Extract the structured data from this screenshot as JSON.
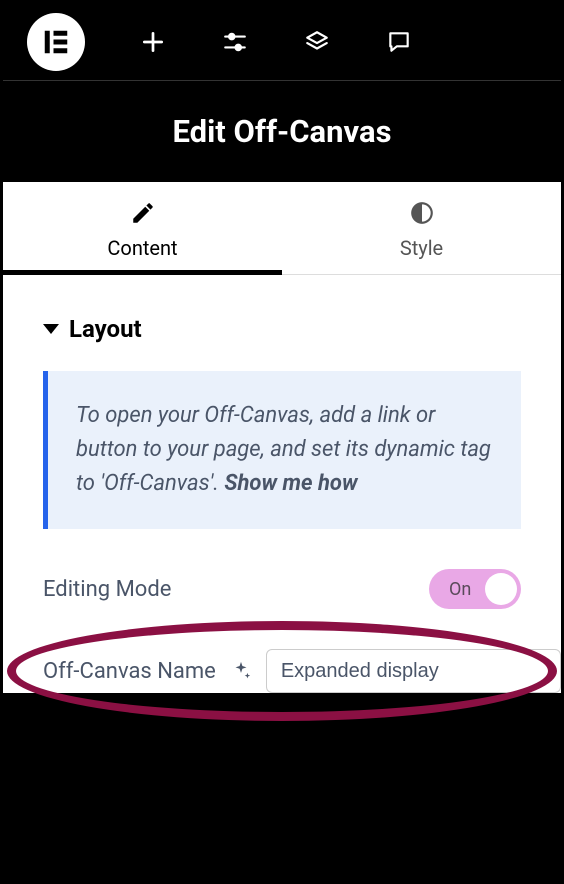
{
  "header": {
    "title": "Edit Off-Canvas"
  },
  "tabs": {
    "content": "Content",
    "style": "Style"
  },
  "section": {
    "layout_title": "Layout"
  },
  "notice": {
    "text": "To open your Off-Canvas, add a link or button to your page, and set its dynamic tag to 'Off-Canvas'. ",
    "link": "Show me how"
  },
  "controls": {
    "editing_mode_label": "Editing Mode",
    "editing_mode_toggle": "On",
    "off_canvas_name_label": "Off-Canvas Name",
    "off_canvas_name_value": "Expanded display"
  }
}
